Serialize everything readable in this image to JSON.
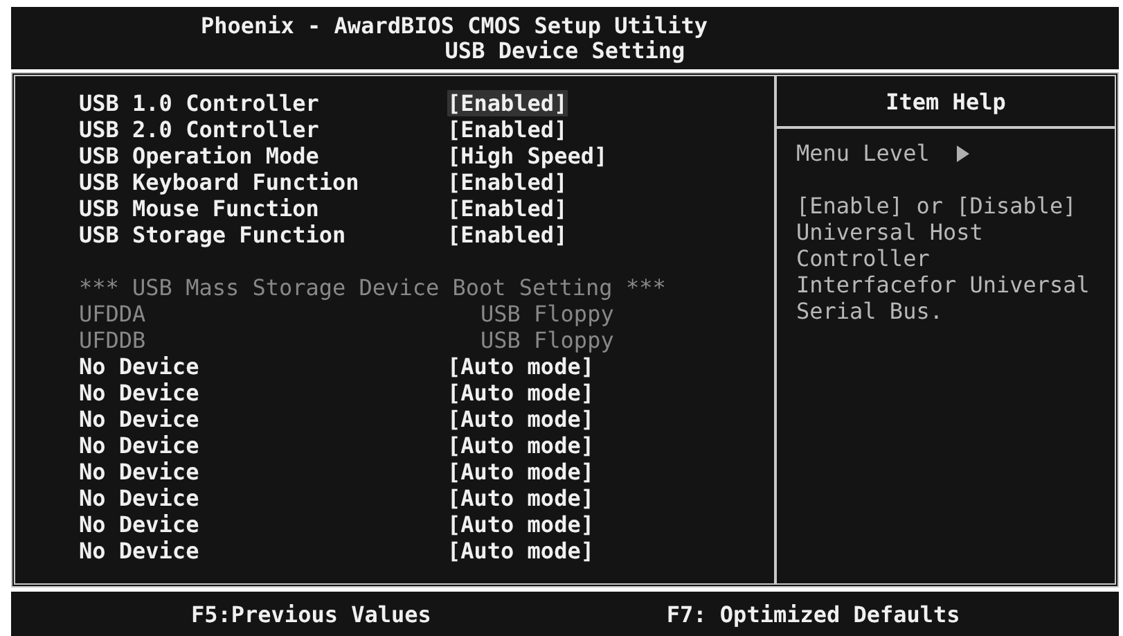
{
  "header": {
    "title": "Phoenix - AwardBIOS CMOS Setup Utility",
    "subtitle": "USB Device Setting"
  },
  "settings": [
    {
      "kind": "setting",
      "label": "USB 1.0 Controller",
      "value": "[Enabled]",
      "disabled": false,
      "selected": true
    },
    {
      "kind": "setting",
      "label": "USB 2.0 Controller",
      "value": "[Enabled]",
      "disabled": false,
      "selected": false
    },
    {
      "kind": "setting",
      "label": "USB Operation Mode",
      "value": "[High Speed]",
      "disabled": false,
      "selected": false
    },
    {
      "kind": "setting",
      "label": "USB Keyboard Function",
      "value": "[Enabled]",
      "disabled": false,
      "selected": false
    },
    {
      "kind": "setting",
      "label": "USB Mouse Function",
      "value": "[Enabled]",
      "disabled": false,
      "selected": false
    },
    {
      "kind": "setting",
      "label": "USB Storage Function",
      "value": "[Enabled]",
      "disabled": false,
      "selected": false
    },
    {
      "kind": "spacer"
    },
    {
      "kind": "heading",
      "label": "*** USB Mass Storage Device Boot Setting ***"
    },
    {
      "kind": "setting",
      "label": "UFDDA",
      "value": "USB Floppy",
      "disabled": true,
      "selected": false
    },
    {
      "kind": "setting",
      "label": "UFDDB",
      "value": "USB Floppy",
      "disabled": true,
      "selected": false
    },
    {
      "kind": "setting",
      "label": "No Device",
      "value": "[Auto mode]",
      "disabled": false,
      "selected": false
    },
    {
      "kind": "setting",
      "label": "No Device",
      "value": "[Auto mode]",
      "disabled": false,
      "selected": false
    },
    {
      "kind": "setting",
      "label": "No Device",
      "value": "[Auto mode]",
      "disabled": false,
      "selected": false
    },
    {
      "kind": "setting",
      "label": "No Device",
      "value": "[Auto mode]",
      "disabled": false,
      "selected": false
    },
    {
      "kind": "setting",
      "label": "No Device",
      "value": "[Auto mode]",
      "disabled": false,
      "selected": false
    },
    {
      "kind": "setting",
      "label": "No Device",
      "value": "[Auto mode]",
      "disabled": false,
      "selected": false
    },
    {
      "kind": "setting",
      "label": "No Device",
      "value": "[Auto mode]",
      "disabled": false,
      "selected": false
    },
    {
      "kind": "setting",
      "label": "No Device",
      "value": "[Auto mode]",
      "disabled": false,
      "selected": false
    }
  ],
  "item_help": {
    "title": "Item Help",
    "menu_level": "Menu Level",
    "text": [
      "[Enable] or [Disable]",
      "Universal Host",
      "Controller",
      "Interfacefor Universal",
      "Serial Bus."
    ]
  },
  "status_bar": [
    "F5:Previous Values",
    "F7: Optimized Defaults"
  ]
}
